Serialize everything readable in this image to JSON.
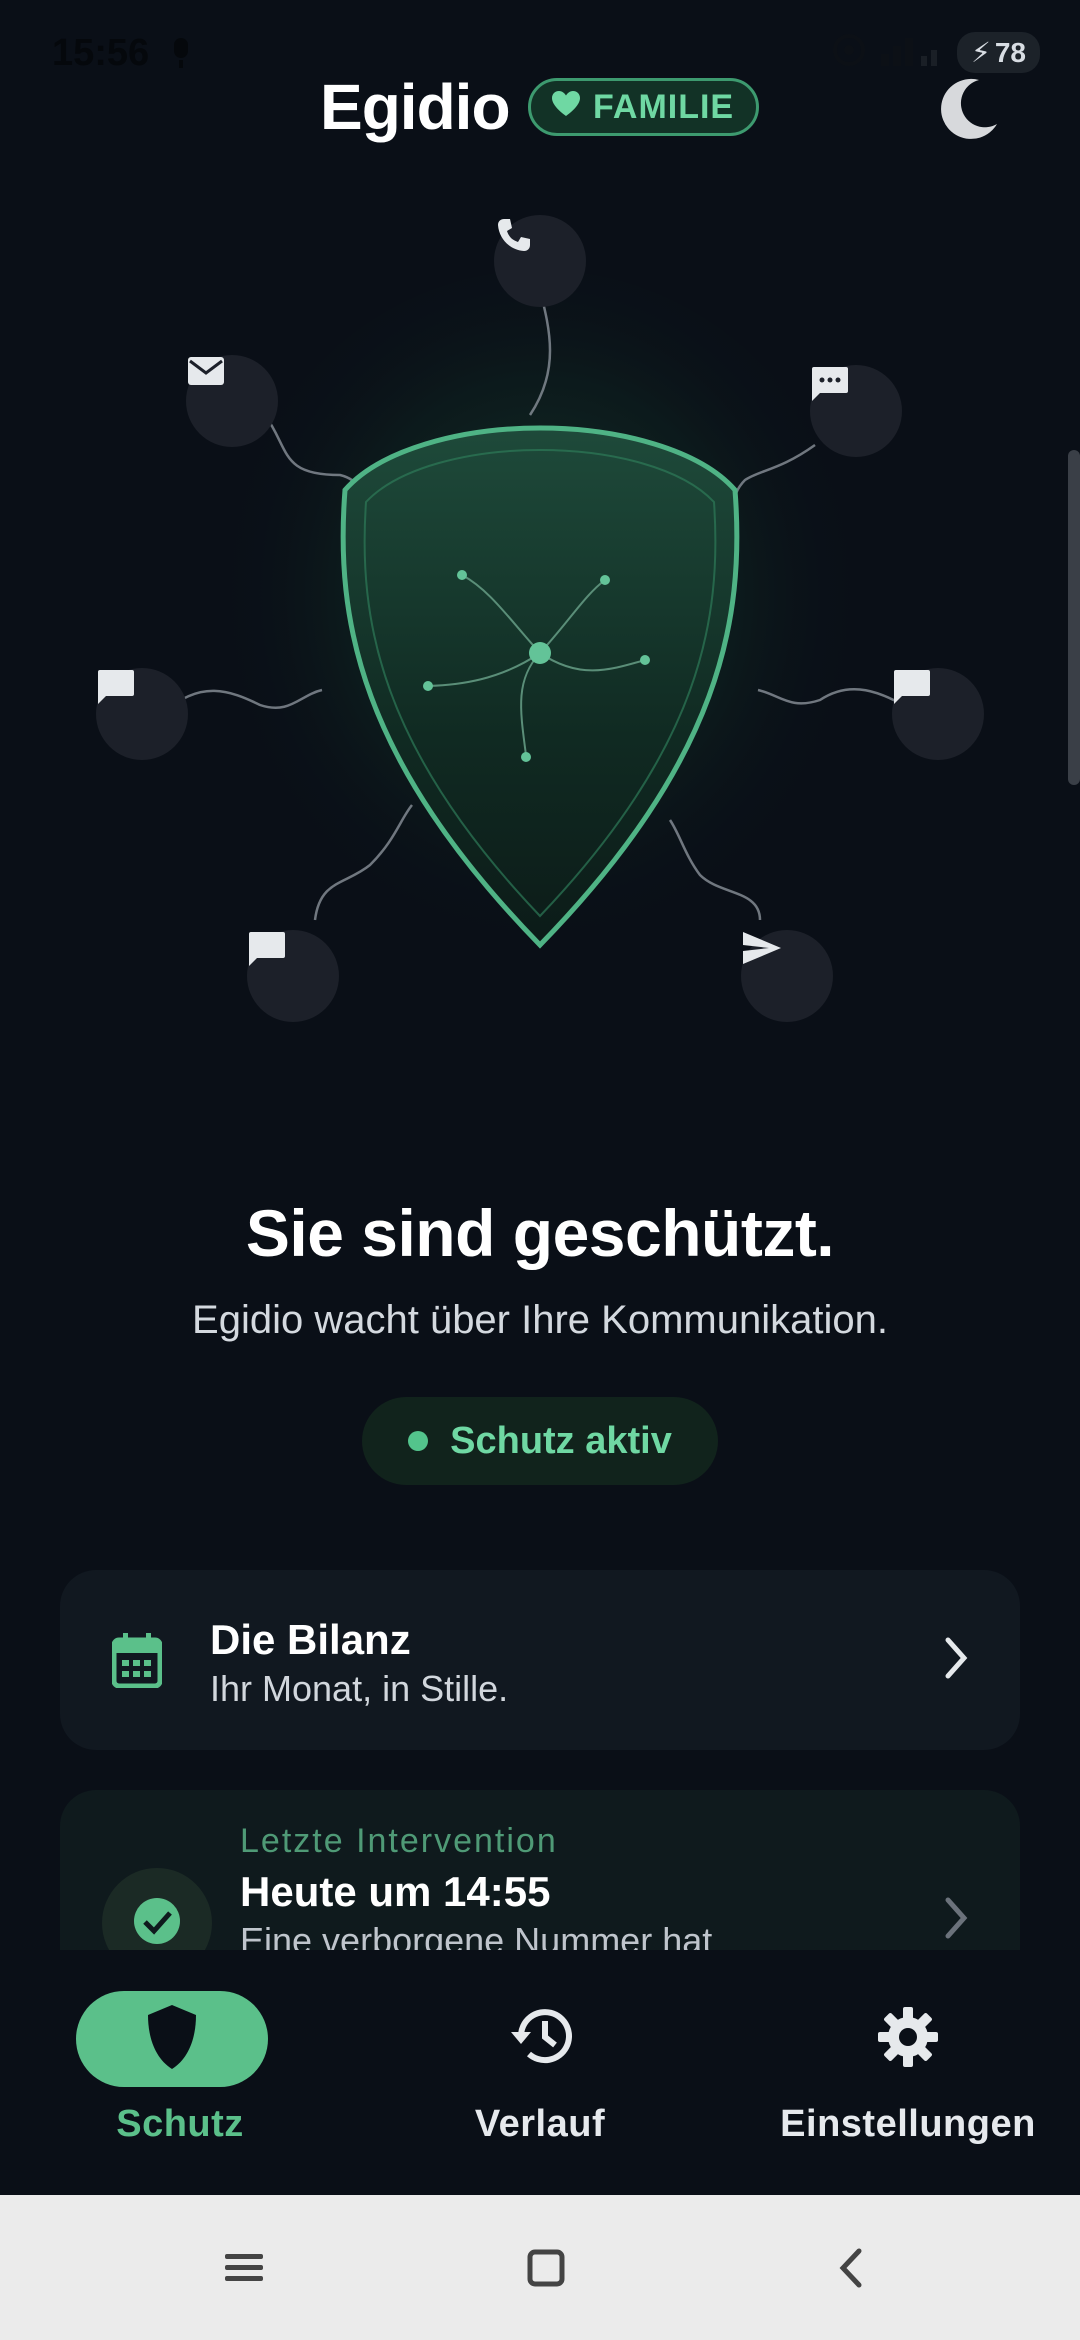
{
  "status_bar": {
    "time": "15:56",
    "battery": "78"
  },
  "header": {
    "title": "Egidio",
    "plan_badge": "FAMILIE"
  },
  "hero": {
    "headline": "Sie sind geschützt.",
    "subline": "Egidio wacht über Ihre Kommunikation.",
    "status_chip": "Schutz aktiv"
  },
  "cards": {
    "bilanz": {
      "title": "Die Bilanz",
      "subtitle": "Ihr Monat, in Stille."
    },
    "intervention": {
      "label": "Letzte Intervention",
      "title": "Heute um 14:55",
      "subtitle": "Eine verborgene Nummer hat"
    }
  },
  "bottom_nav": {
    "items": [
      {
        "label": "Schutz",
        "icon": "shield-icon",
        "active": true
      },
      {
        "label": "Verlauf",
        "icon": "history-icon",
        "active": false
      },
      {
        "label": "Einstellungen",
        "icon": "gear-icon",
        "active": false
      }
    ]
  },
  "colors": {
    "background": "#0a0f17",
    "accent": "#5bc08a",
    "accent_text": "#6fd8a3",
    "card": "#111820"
  }
}
